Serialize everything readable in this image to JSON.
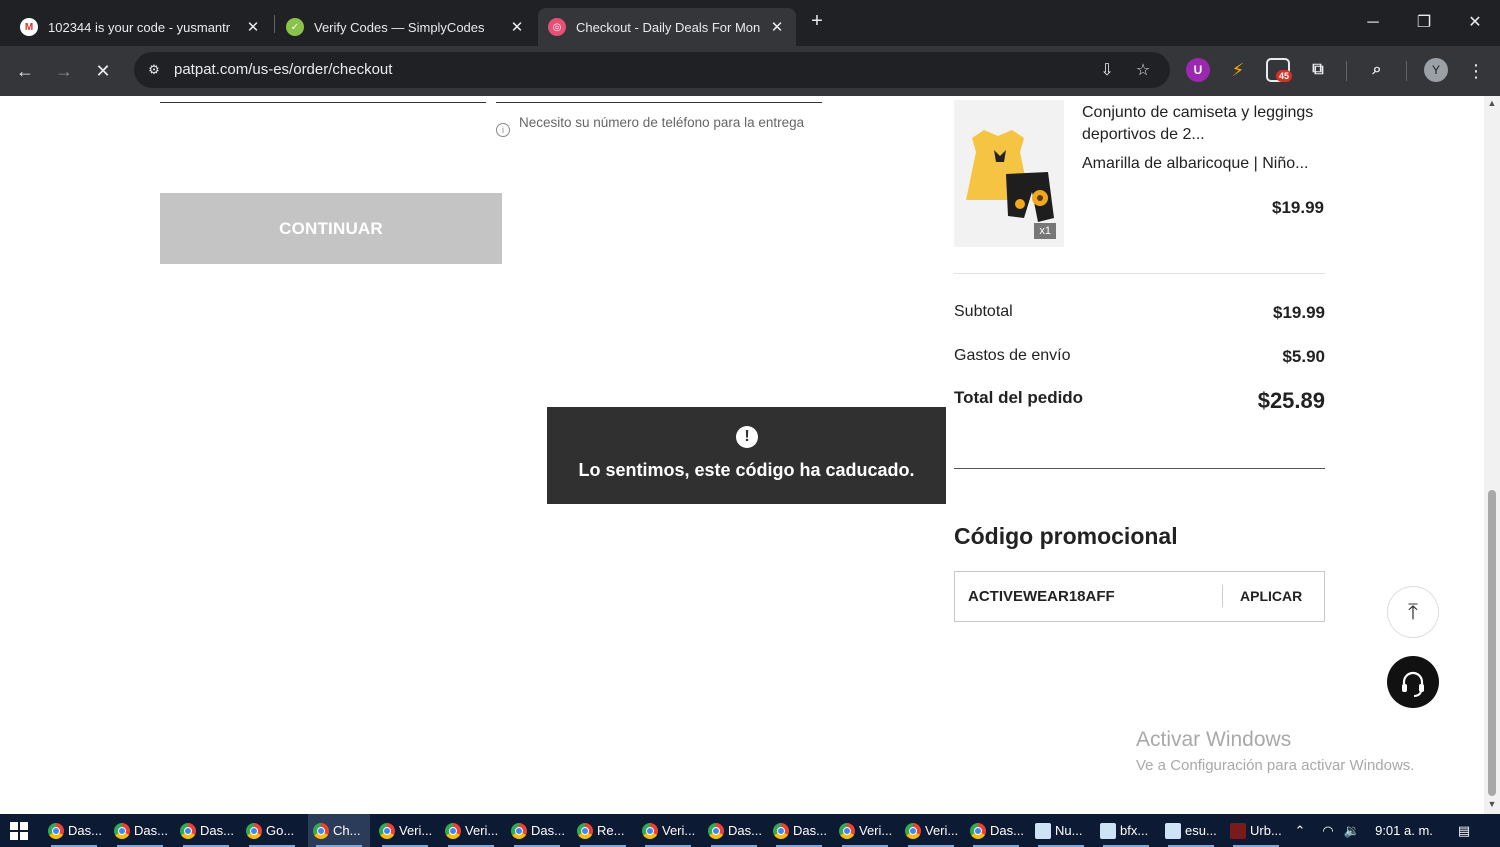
{
  "browser": {
    "tabs": [
      {
        "title": "102344 is your code - yusmantr",
        "icon": "gmail-icon",
        "active": false
      },
      {
        "title": "Verify Codes — SimplyCodes",
        "icon": "simplycodes-icon",
        "active": false
      },
      {
        "title": "Checkout - Daily Deals For Mon",
        "icon": "patpat-icon",
        "active": true
      }
    ],
    "url": "patpat.com/us-es/order/checkout",
    "extension_badge": "45",
    "avatar_letter": "Y"
  },
  "checkout": {
    "phone_hint": "Necesito su número de teléfono para la entrega",
    "continue_label": "CONTINUAR"
  },
  "toast": {
    "message": "Lo sentimos, este código ha caducado."
  },
  "order": {
    "product": {
      "title": "Conjunto de camiseta y leggings deportivos de 2...",
      "variant": "Amarilla de albaricoque | Niño...",
      "price": "$19.99",
      "quantity": "x1"
    },
    "summary": {
      "subtotal_label": "Subtotal",
      "subtotal_value": "$19.99",
      "shipping_label": "Gastos de envío",
      "shipping_value": "$5.90",
      "total_label": "Total del pedido",
      "total_value": "$25.89"
    },
    "promo": {
      "title": "Código promocional",
      "code": "ACTIVEWEAR18AFF",
      "apply_label": "APLICAR"
    }
  },
  "watermark": {
    "line1": "Activar Windows",
    "line2": "Ve a Configuración para activar Windows."
  },
  "taskbar": {
    "items": [
      "Das...",
      "Das...",
      "Das...",
      "Go...",
      "Ch...",
      "Veri...",
      "Veri...",
      "Das...",
      "Re...",
      "Veri...",
      "Das...",
      "Das...",
      "Veri...",
      "Veri...",
      "Das...",
      "Nu...",
      "bfx...",
      "esu...",
      "Urb..."
    ],
    "time": "9:01 a. m."
  },
  "colors": {
    "chrome_dark": "#202124",
    "chrome_toolbar": "#35363a",
    "button_disabled": "#c4c4c4",
    "toast_bg": "#303030",
    "taskbar": "#0d1a33"
  }
}
